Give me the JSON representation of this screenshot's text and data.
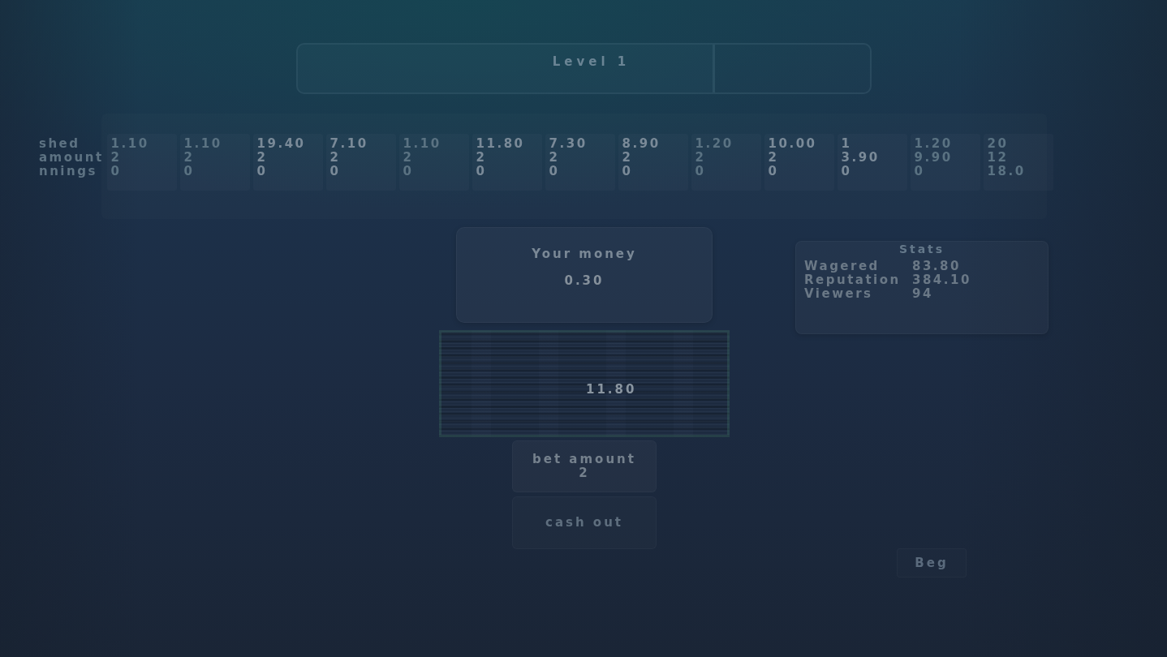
{
  "level_bar": {
    "label": "Level 1",
    "level": 0.73
  },
  "history": {
    "row_labels": [
      "shed",
      "amount",
      "nnings"
    ],
    "columns": [
      {
        "values": [
          "1.10",
          "2",
          "0"
        ],
        "dimmed": true
      },
      {
        "values": [
          "1.10",
          "2",
          "0"
        ],
        "dimmed": true
      },
      {
        "values": [
          "19.40",
          "2",
          "0"
        ],
        "dimmed": false
      },
      {
        "values": [
          "7.10",
          "2",
          "0"
        ],
        "dimmed": false
      },
      {
        "values": [
          "1.10",
          "2",
          "0"
        ],
        "dimmed": true
      },
      {
        "values": [
          "11.80",
          "2",
          "0"
        ],
        "dimmed": false
      },
      {
        "values": [
          "7.30",
          "2",
          "0"
        ],
        "dimmed": false
      },
      {
        "values": [
          "8.90",
          "2",
          "0"
        ],
        "dimmed": false
      },
      {
        "values": [
          "1.20",
          "2",
          "0"
        ],
        "dimmed": true
      },
      {
        "values": [
          "10.00",
          "2",
          "0"
        ],
        "dimmed": false
      },
      {
        "values": [
          "1",
          "3.90",
          "0"
        ],
        "dimmed": false
      },
      {
        "values": [
          "1.20",
          "9.90",
          "0"
        ],
        "dimmed": true
      },
      {
        "values": [
          "20",
          "12",
          "18.0"
        ],
        "dimmed": true
      }
    ]
  },
  "money": {
    "title": "Your money",
    "value": "0.30"
  },
  "multiplier": {
    "value": "11.80"
  },
  "buttons": [
    {
      "label": "bet amount",
      "value": "2",
      "disabled": false
    },
    {
      "label": "cash out",
      "disabled": true
    }
  ],
  "stats": {
    "title": "Stats",
    "rows": [
      {
        "label": "Wagered",
        "value": "83.80"
      },
      {
        "label": "Reputation",
        "value": "384.10"
      },
      {
        "label": "Viewers",
        "value": "94"
      }
    ]
  },
  "beg_button": {
    "label": "Beg",
    "disabled": true
  }
}
